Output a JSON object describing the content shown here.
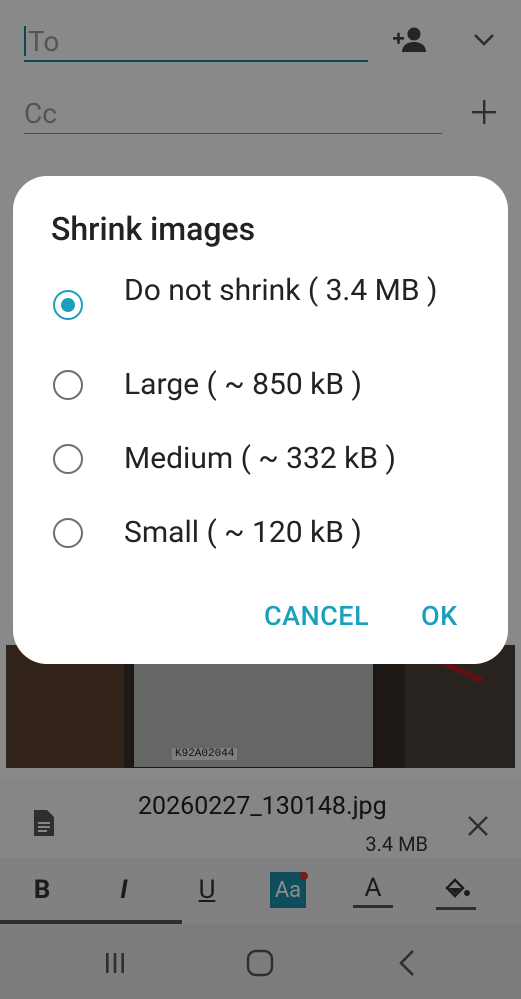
{
  "compose": {
    "to_label": "To",
    "cc_label": "Cc",
    "attachment": {
      "filename": "20260227_130148.jpg",
      "size": "3.4 MB"
    },
    "photo_label": "K92A02044"
  },
  "toolbar": {
    "bold": "B",
    "italic": "I",
    "underline": "U",
    "font_style": "Aa",
    "text_color": "A"
  },
  "dialog": {
    "title": "Shrink images",
    "options": [
      {
        "label": "Do not shrink ( 3.4 MB )",
        "checked": true
      },
      {
        "label": "Large ( ~ 850 kB )",
        "checked": false
      },
      {
        "label": "Medium ( ~ 332 kB )",
        "checked": false
      },
      {
        "label": "Small ( ~ 120 kB )",
        "checked": false
      }
    ],
    "cancel": "CANCEL",
    "ok": "OK"
  },
  "colors": {
    "accent": "#1aa0bb",
    "to_underline": "#1d7e9a"
  }
}
